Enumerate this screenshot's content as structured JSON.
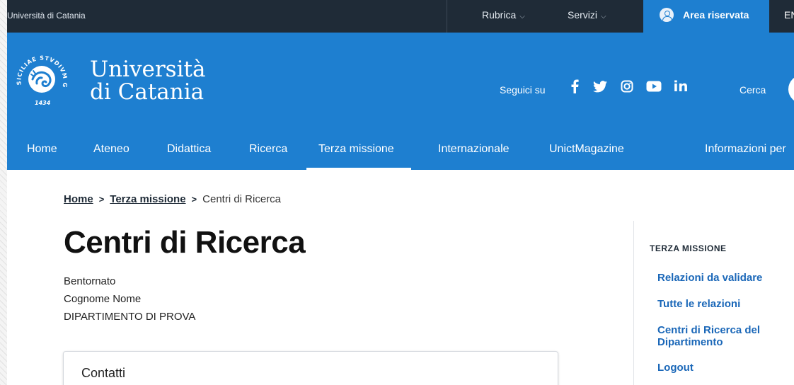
{
  "topbar": {
    "university_link": "Università di Catania",
    "menus": [
      {
        "label": "Rubrica"
      },
      {
        "label": "Servizi"
      }
    ],
    "area_riservata": "Area riservata",
    "language": "EN"
  },
  "header": {
    "logo_line1": "Università",
    "logo_line2": "di Catania",
    "seal_text": "SICILIAE STVDIVM GENERALE",
    "seal_year": "1434",
    "follow_label": "Seguici su",
    "socials": [
      "facebook-icon",
      "twitter-icon",
      "instagram-icon",
      "youtube-icon",
      "linkedin-icon"
    ],
    "search_label": "Cerca"
  },
  "nav": {
    "items": [
      {
        "label": "Home"
      },
      {
        "label": "Ateneo"
      },
      {
        "label": "Didattica"
      },
      {
        "label": "Ricerca"
      },
      {
        "label": "Terza missione"
      },
      {
        "label": "Internazionale"
      },
      {
        "label": "UnictMagazine"
      },
      {
        "label": "Informazioni per"
      }
    ],
    "active": "Terza missione"
  },
  "breadcrumb": {
    "home": "Home",
    "section": "Terza missione",
    "current": "Centri di Ricerca",
    "separator": ">"
  },
  "main": {
    "title": "Centri di Ricerca",
    "greeting": "Bentornato",
    "user_name": "Cognome Nome",
    "department": "DIPARTIMENTO DI PROVA",
    "card_title": "Contatti"
  },
  "sidebar": {
    "heading": "TERZA MISSIONE",
    "links": [
      {
        "label": "Relazioni da validare"
      },
      {
        "label": "Tutte le relazioni"
      },
      {
        "label": "Centri di Ricerca del Dipartimento"
      },
      {
        "label": "Logout"
      }
    ]
  },
  "colors": {
    "brand_blue": "#1e7fd0",
    "topbar_dark": "#1f2b37",
    "link_blue": "#1a67b8"
  }
}
